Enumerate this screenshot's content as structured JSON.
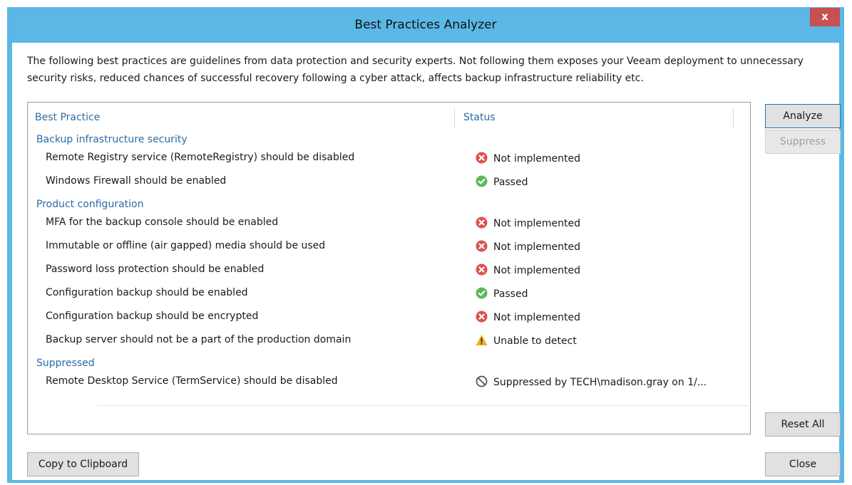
{
  "window": {
    "title": "Best Practices Analyzer",
    "close_label": "x"
  },
  "description": "The following best practices are guidelines from data protection and security experts. Not following them exposes your Veeam deployment to unnecessary security risks, reduced chances of successful recovery following a cyber attack, affects backup infrastructure reliability etc.",
  "table": {
    "columns": [
      "Best Practice",
      "Status"
    ],
    "groups": [
      {
        "name": "Backup infrastructure security",
        "rows": [
          {
            "label": "Remote Registry service (RemoteRegistry) should be disabled",
            "status": "Not implemented",
            "icon": "error-icon"
          },
          {
            "label": "Windows Firewall should be enabled",
            "status": "Passed",
            "icon": "check-icon"
          }
        ]
      },
      {
        "name": "Product configuration",
        "rows": [
          {
            "label": "MFA for the backup console should be enabled",
            "status": "Not implemented",
            "icon": "error-icon"
          },
          {
            "label": "Immutable or offline (air gapped) media should be used",
            "status": "Not implemented",
            "icon": "error-icon"
          },
          {
            "label": "Password loss protection should be enabled",
            "status": "Not implemented",
            "icon": "error-icon"
          },
          {
            "label": "Configuration backup should be enabled",
            "status": "Passed",
            "icon": "check-icon"
          },
          {
            "label": "Configuration backup should be encrypted",
            "status": "Not implemented",
            "icon": "error-icon"
          },
          {
            "label": "Backup server should not be a part of the production domain",
            "status": "Unable to detect",
            "icon": "warning-icon"
          }
        ]
      },
      {
        "name": "Suppressed",
        "rows": [
          {
            "label": "Remote Desktop Service (TermService) should be disabled",
            "status": "Suppressed by TECH\\madison.gray on 1/...",
            "icon": "suppressed-icon"
          }
        ]
      }
    ]
  },
  "buttons": {
    "analyze": "Analyze",
    "suppress": "Suppress",
    "reset_all": "Reset All",
    "copy": "Copy to Clipboard",
    "close": "Close"
  },
  "colors": {
    "titlebar": "#5bb8e6",
    "close_button": "#c75050",
    "header_text": "#2b6ca3",
    "error": "#d9534f",
    "passed": "#5cb85c",
    "warning": "#f0ad1f"
  }
}
